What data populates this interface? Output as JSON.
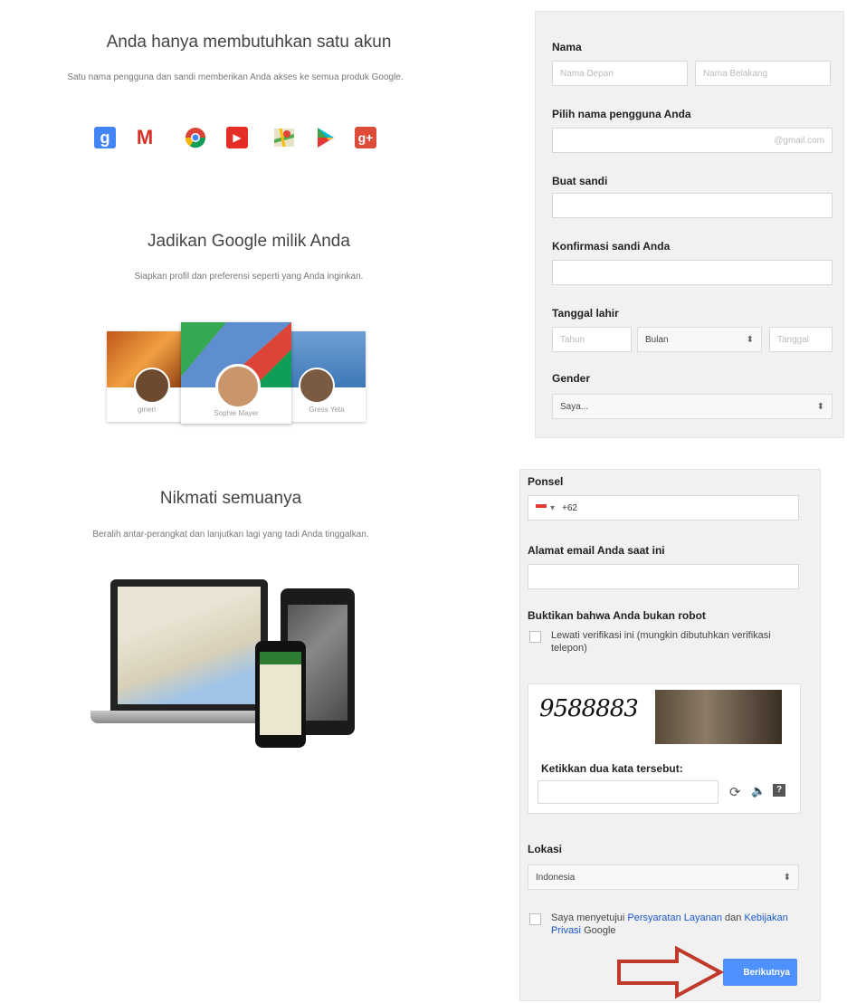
{
  "left": {
    "section1": {
      "heading": "Anda hanya membutuhkan satu akun",
      "subtext": "Satu nama pengguna dan sandi memberikan Anda akses ke semua produk Google."
    },
    "services": [
      {
        "name": "search-icon",
        "glyph": "g",
        "color": "#4285f4"
      },
      {
        "name": "gmail-icon",
        "glyph": "M",
        "color": "#d93025"
      },
      {
        "name": "chrome-icon",
        "glyph": "",
        "color": "#f2b400"
      },
      {
        "name": "youtube-icon",
        "glyph": "▶",
        "color": "#e52d27"
      },
      {
        "name": "maps-icon",
        "glyph": "",
        "color": "#34a853"
      },
      {
        "name": "play-icon",
        "glyph": "▶",
        "color": "#1e88e5"
      },
      {
        "name": "google-plus-icon",
        "glyph": "g+",
        "color": "#dd4b39"
      }
    ],
    "section2": {
      "heading": "Jadikan Google milik Anda",
      "subtext": "Siapkan profil dan preferensi seperti yang Anda inginkan."
    },
    "profiles": [
      {
        "caption": "gmeri"
      },
      {
        "caption": "Sophie Mayer"
      },
      {
        "caption": "Gress Yeta"
      }
    ],
    "section3": {
      "heading": "Nikmati semuanya",
      "subtext": "Beralih antar-perangkat dan lanjutkan lagi yang tadi Anda tinggalkan."
    }
  },
  "form_top": {
    "name_label": "Nama",
    "first_name_placeholder": "Nama Depan",
    "last_name_placeholder": "Nama Belakang",
    "username_label": "Pilih nama pengguna Anda",
    "username_suffix": "@gmail.com",
    "password_label": "Buat sandi",
    "confirm_label": "Konfirmasi sandi Anda",
    "birthday_label": "Tanggal lahir",
    "year_placeholder": "Tahun",
    "month_value": "Bulan",
    "day_placeholder": "Tanggal",
    "gender_label": "Gender",
    "gender_value": "Saya..."
  },
  "form_bottom": {
    "phone_label": "Ponsel",
    "phone_code": "+62",
    "email_label": "Alamat email Anda saat ini",
    "robot_label": "Buktikan bahwa Anda bukan robot",
    "skip_verify_text": "Lewati verifikasi ini (mungkin dibutuhkan verifikasi telepon)",
    "captcha_text": "9588883",
    "captcha_prompt": "Ketikkan dua kata tersebut:",
    "location_label": "Lokasi",
    "location_value": "Indonesia",
    "agree_prefix": "Saya menyetujui",
    "terms_link": "Persyaratan Layanan",
    "agree_and": "dan",
    "privacy_link": "Kebijakan Privasi",
    "agree_suffix": "Google",
    "next_button": "Berikutnya"
  },
  "arrow_color": "#c0392b"
}
